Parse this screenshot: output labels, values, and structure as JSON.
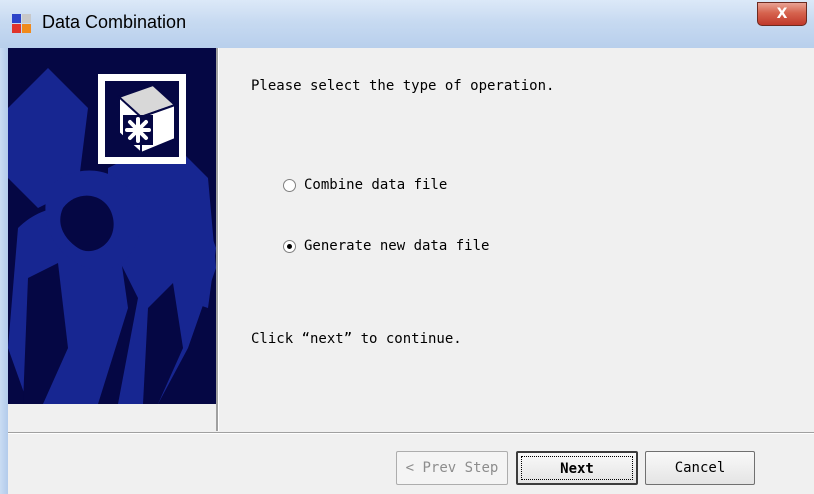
{
  "window": {
    "title": "Data Combination",
    "close_glyph": "X"
  },
  "sidebar": {
    "logo_icon": "asterisk-box-icon"
  },
  "main": {
    "prompt": "Please select the type of operation.",
    "options": [
      {
        "label": "Combine data file",
        "selected": false
      },
      {
        "label": "Generate new data file",
        "selected": true
      }
    ],
    "instruction": "Click “next” to continue."
  },
  "buttons": {
    "prev": "< Prev Step",
    "next": "Next",
    "cancel": "Cancel"
  },
  "colors": {
    "sidebar_bg": "#050744",
    "sidebar_art": "#1a2a9a",
    "dialog_bg": "#f0f0f0"
  }
}
